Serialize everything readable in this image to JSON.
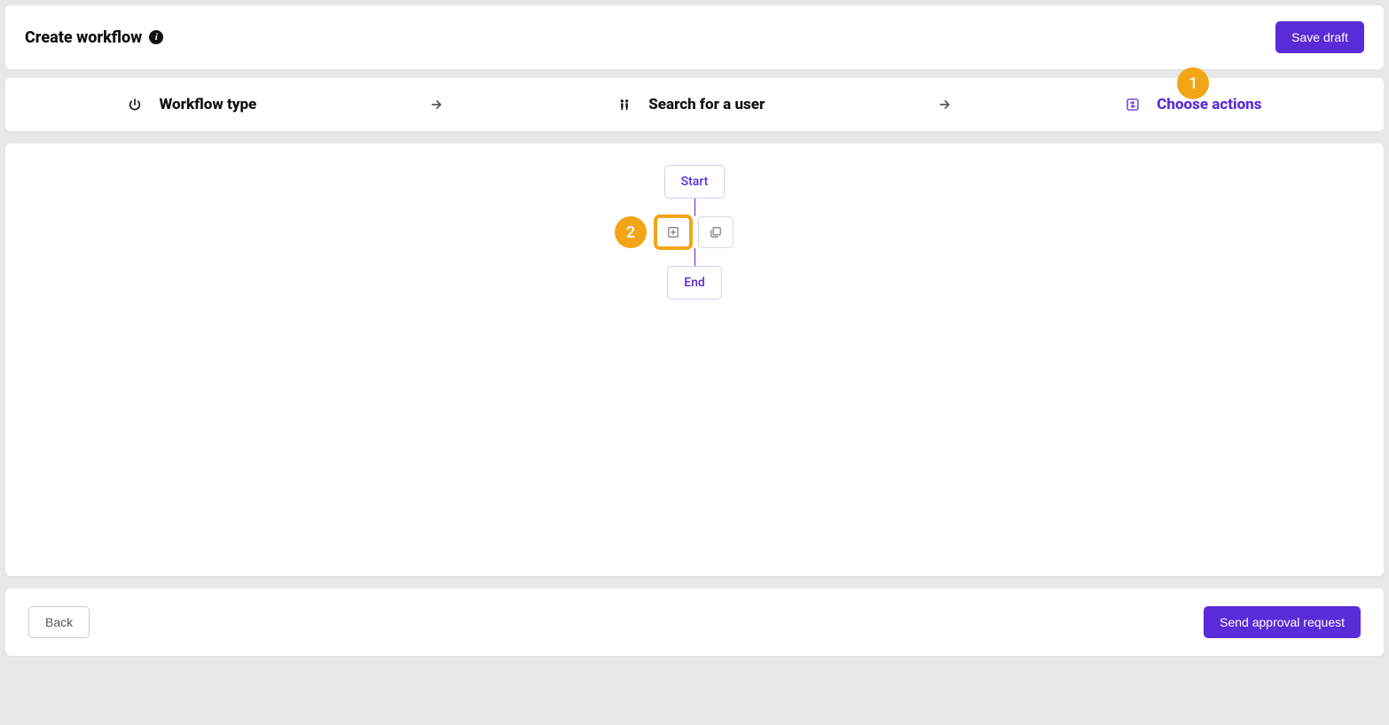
{
  "header": {
    "title": "Create workflow",
    "save_draft_label": "Save draft"
  },
  "stepper": {
    "steps": [
      {
        "label": "Workflow type",
        "icon": "power-icon",
        "active": false
      },
      {
        "label": "Search for a user",
        "icon": "people-icon",
        "active": false
      },
      {
        "label": "Choose actions",
        "icon": "swap-icon",
        "active": true
      }
    ]
  },
  "annotations": {
    "badge1": "1",
    "badge2": "2"
  },
  "flow": {
    "start_label": "Start",
    "end_label": "End"
  },
  "footer": {
    "back_label": "Back",
    "send_label": "Send approval request"
  }
}
